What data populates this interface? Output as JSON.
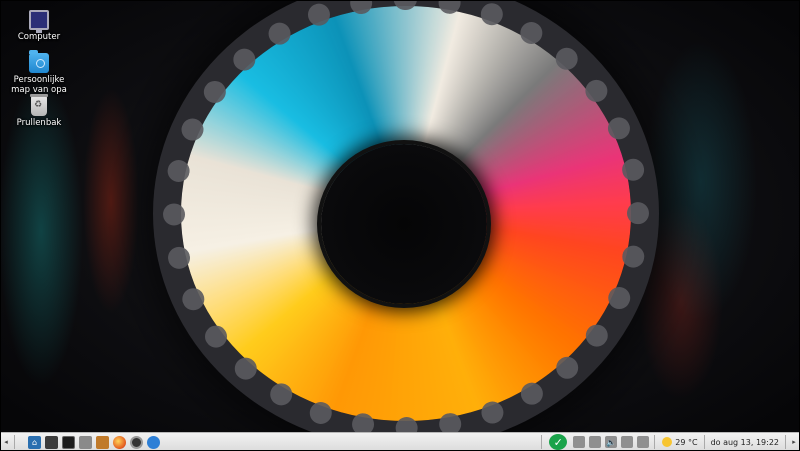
{
  "desktop": {
    "icons": [
      {
        "label": "Computer",
        "icon": "computer-icon"
      },
      {
        "label": "Persoonlijke map van opa",
        "icon": "home-folder-icon"
      },
      {
        "label": "Prullenbak",
        "icon": "trash-icon"
      }
    ]
  },
  "taskbar": {
    "left_arrow": "◂",
    "right_arrow": "▸",
    "launchers": [
      "start-menu-icon",
      "file-manager-icon",
      "terminal-icon",
      "task-manager-icon",
      "software-store-icon",
      "firefox-icon",
      "webcam-icon",
      "thunderbird-icon"
    ],
    "tray": {
      "update_status": "✓",
      "weather": "29 °C",
      "clock": "do aug 13, 19:22"
    }
  },
  "colors": {
    "taskbar_bg": "#e8e8e8",
    "update_ok": "#1aa34a"
  }
}
